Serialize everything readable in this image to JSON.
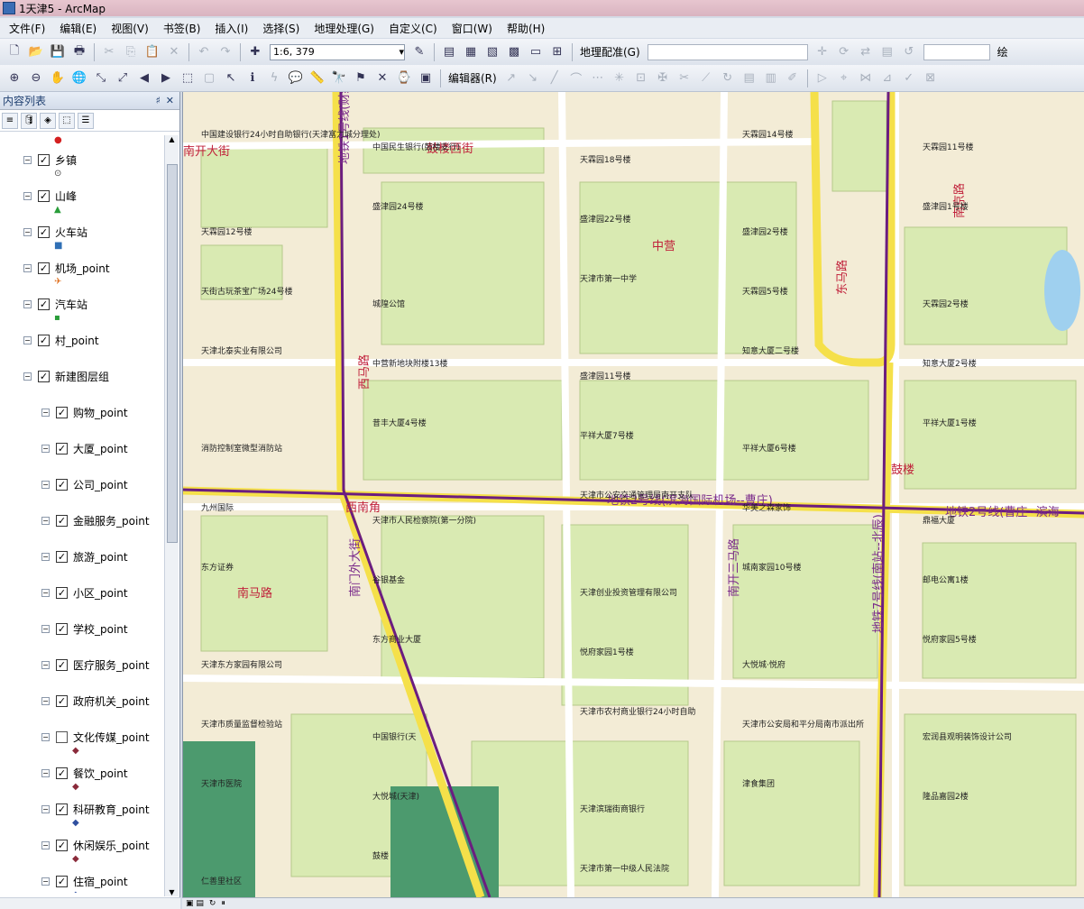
{
  "window": {
    "title": "1天津5 - ArcMap"
  },
  "menu": [
    "文件(F)",
    "编辑(E)",
    "视图(V)",
    "书签(B)",
    "插入(I)",
    "选择(S)",
    "地理处理(G)",
    "自定义(C)",
    "窗口(W)",
    "帮助(H)"
  ],
  "toolbar": {
    "scale": "1:6, 379",
    "georef_label": "地理配准(G)",
    "editor_label": "编辑器(R)",
    "right_label": "绘"
  },
  "toc": {
    "title": "内容列表",
    "pin": "♯",
    "close": "✕",
    "layers": [
      {
        "name": "乡镇",
        "checked": true,
        "symbol": "⊙",
        "symbol_color": "#444",
        "indent": 0
      },
      {
        "name": "山峰",
        "checked": true,
        "symbol": "▲",
        "symbol_color": "#2a9d3a",
        "indent": 0
      },
      {
        "name": "火车站",
        "checked": true,
        "symbol": "■",
        "symbol_color": "#2f6fb5",
        "indent": 0
      },
      {
        "name": "机场_point",
        "checked": true,
        "symbol": "✈",
        "symbol_color": "#e07020",
        "indent": 0
      },
      {
        "name": "汽车站",
        "checked": true,
        "symbol": "▪",
        "symbol_color": "#2a9d3a",
        "indent": 0
      },
      {
        "name": "村_point",
        "checked": true,
        "symbol": "",
        "symbol_color": "#444",
        "indent": 0
      },
      {
        "name": "新建图层组",
        "checked": true,
        "symbol": "",
        "symbol_color": "#444",
        "indent": 0
      },
      {
        "name": "购物_point",
        "checked": true,
        "symbol": "",
        "symbol_color": "#444",
        "indent": 1
      },
      {
        "name": "大厦_point",
        "checked": true,
        "symbol": "",
        "symbol_color": "#444",
        "indent": 1
      },
      {
        "name": "公司_point",
        "checked": true,
        "symbol": "",
        "symbol_color": "#444",
        "indent": 1
      },
      {
        "name": "金融服务_point",
        "checked": true,
        "symbol": "",
        "symbol_color": "#444",
        "indent": 1
      },
      {
        "name": "旅游_point",
        "checked": true,
        "symbol": "",
        "symbol_color": "#444",
        "indent": 1
      },
      {
        "name": "小区_point",
        "checked": true,
        "symbol": "",
        "symbol_color": "#444",
        "indent": 1
      },
      {
        "name": "学校_point",
        "checked": true,
        "symbol": "",
        "symbol_color": "#444",
        "indent": 1
      },
      {
        "name": "医疗服务_point",
        "checked": true,
        "symbol": "",
        "symbol_color": "#444",
        "indent": 1
      },
      {
        "name": "政府机关_point",
        "checked": true,
        "symbol": "",
        "symbol_color": "#444",
        "indent": 1
      },
      {
        "name": "文化传媒_point",
        "checked": false,
        "symbol": "◆",
        "symbol_color": "#8a2a3a",
        "indent": 1
      },
      {
        "name": "餐饮_point",
        "checked": true,
        "symbol": "◆",
        "symbol_color": "#8a2a3a",
        "indent": 1
      },
      {
        "name": "科研教育_point",
        "checked": true,
        "symbol": "◆",
        "symbol_color": "#2f4f9f",
        "indent": 1
      },
      {
        "name": "休闲娱乐_point",
        "checked": true,
        "symbol": "◆",
        "symbol_color": "#8a2a3a",
        "indent": 1
      },
      {
        "name": "住宿_point",
        "checked": true,
        "symbol": "◆",
        "symbol_color": "#2f4f9f",
        "indent": 1
      }
    ]
  },
  "map": {
    "roads": [
      "南开大街",
      "鼓楼西街",
      "西马路",
      "地铁1号线(财经大学--刘园)",
      "地铁2号线(滨海国际机场--曹庄)",
      "地铁2号线(曹庄--滨海",
      "地铁7号线(南站--北辰)",
      "鼓楼",
      "西南角",
      "南门外大街",
      "南马路",
      "东马路",
      "南开三马路",
      "中营",
      "南京路"
    ],
    "labels": [
      "中国建设银行24小时自助银行(天津富力城分理处)",
      "中国民生银行(鼓楼支行)",
      "天霖园18号楼",
      "天霖园14号楼",
      "天霖园11号楼",
      "天霖园12号楼",
      "盛津园24号楼",
      "盛津园22号楼",
      "盛津园2号楼",
      "盛津园1号楼",
      "天街古玩茶宝广场24号楼",
      "城隍公馆",
      "天津市第一中学",
      "天霖园5号楼",
      "天霖园2号楼",
      "天津北泰实业有限公司",
      "中营新地块附楼13楼",
      "盛津园11号楼",
      "知意大厦二号楼",
      "知意大厦2号楼",
      "消防控制室微型消防站",
      "昔丰大厦4号楼",
      "平祥大厦7号楼",
      "平祥大厦6号楼",
      "平祥大厦1号楼",
      "九州国际",
      "天津市人民检察院(第一分院)",
      "天津市公安交通管理局南开支队",
      "华美之森家饰",
      "鼎福大厦",
      "东方证券",
      "谷银基金",
      "天津创业投资管理有限公司",
      "城南家园10号楼",
      "邮电公寓1楼",
      "天津东方家园有限公司",
      "东方商业大厦",
      "悦府家园1号楼",
      "大悦城·悦府",
      "悦府家园5号楼",
      "天津市质量监督检验站",
      "中国银行(天",
      "天津市农村商业银行24小时自助",
      "天津市公安局和平分局南市派出所",
      "宏润县观明装饰设计公司",
      "天津市医院",
      "大悦城(天津)",
      "天津滨瑞街商银行",
      "津食集团",
      "隆品嘉园2楼",
      "仁善里社区",
      "鼓楼",
      "天津市第一中级人民法院"
    ]
  },
  "status": {
    "page_icons": "▣ ▤",
    "refresh": "↻",
    "pause": "⏸"
  }
}
